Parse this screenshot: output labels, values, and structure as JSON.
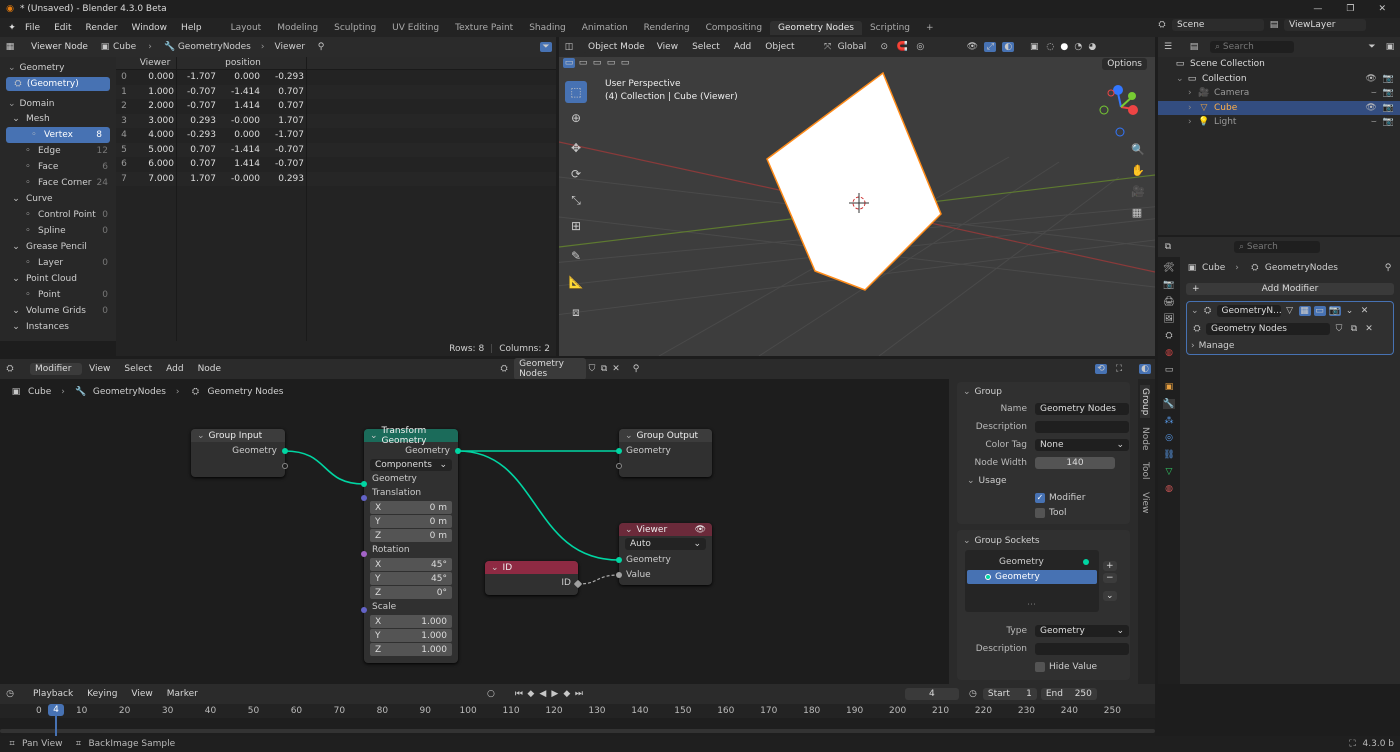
{
  "app_title": "* (Unsaved) - Blender 4.3.0 Beta",
  "menu": [
    "File",
    "Edit",
    "Render",
    "Window",
    "Help"
  ],
  "workspaces": [
    "Layout",
    "Modeling",
    "Sculpting",
    "UV Editing",
    "Texture Paint",
    "Shading",
    "Animation",
    "Rendering",
    "Compositing",
    "Geometry Nodes",
    "Scripting"
  ],
  "scene": "Scene",
  "viewlayer": "ViewLayer",
  "spreadsheet": {
    "mode": "Viewer Node",
    "object": "Cube",
    "modifier": "GeometryNodes",
    "node": "Viewer",
    "geometry_label": "Geometry",
    "geometry_item": "(Geometry)",
    "domain_label": "Domain",
    "tree": [
      {
        "label": "Mesh",
        "count": "",
        "indent": 0
      },
      {
        "label": "Vertex",
        "count": "8",
        "indent": 1
      },
      {
        "label": "Edge",
        "count": "12",
        "indent": 1
      },
      {
        "label": "Face",
        "count": "6",
        "indent": 1
      },
      {
        "label": "Face Corner",
        "count": "24",
        "indent": 1
      },
      {
        "label": "Curve",
        "count": "",
        "indent": 0
      },
      {
        "label": "Control Point",
        "count": "0",
        "indent": 1
      },
      {
        "label": "Spline",
        "count": "0",
        "indent": 1
      },
      {
        "label": "Grease Pencil",
        "count": "",
        "indent": 0
      },
      {
        "label": "Layer",
        "count": "0",
        "indent": 1
      },
      {
        "label": "Point Cloud",
        "count": "",
        "indent": 0
      },
      {
        "label": "Point",
        "count": "0",
        "indent": 1
      },
      {
        "label": "Volume Grids",
        "count": "0",
        "indent": 0
      },
      {
        "label": "Instances",
        "count": "",
        "indent": 0
      }
    ],
    "col_viewer": "Viewer",
    "col_position": "position",
    "rows": [
      [
        "0",
        "0.000",
        "-1.707",
        "0.000",
        "-0.293"
      ],
      [
        "1",
        "1.000",
        "-0.707",
        "-1.414",
        "0.707"
      ],
      [
        "2",
        "2.000",
        "-0.707",
        "1.414",
        "0.707"
      ],
      [
        "3",
        "3.000",
        "0.293",
        "-0.000",
        "1.707"
      ],
      [
        "4",
        "4.000",
        "-0.293",
        "0.000",
        "-1.707"
      ],
      [
        "5",
        "5.000",
        "0.707",
        "-1.414",
        "-0.707"
      ],
      [
        "6",
        "6.000",
        "0.707",
        "1.414",
        "-0.707"
      ],
      [
        "7",
        "7.000",
        "1.707",
        "-0.000",
        "0.293"
      ]
    ],
    "rows_label": "Rows: 8",
    "columns_label": "Columns: 2"
  },
  "viewport": {
    "mode": "Object Mode",
    "menus": [
      "View",
      "Select",
      "Add",
      "Object"
    ],
    "transform": "Global",
    "options": "Options",
    "info_line1": "User Perspective",
    "info_line2": "(4) Collection | Cube (Viewer)"
  },
  "outliner": {
    "search_placeholder": "Search",
    "items": [
      {
        "label": "Scene Collection",
        "indent": 0
      },
      {
        "label": "Collection",
        "indent": 1
      },
      {
        "label": "Camera",
        "indent": 2
      },
      {
        "label": "Cube",
        "indent": 2
      },
      {
        "label": "Light",
        "indent": 2
      }
    ]
  },
  "properties": {
    "search_placeholder": "Search",
    "breadcrumb_object": "Cube",
    "breadcrumb_modifier": "GeometryNodes",
    "add_modifier": "Add Modifier",
    "modifier_name": "GeometryN...",
    "node_group": "Geometry Nodes",
    "manage": "Manage"
  },
  "node_editor": {
    "type": "Modifier",
    "menus": [
      "View",
      "Select",
      "Add",
      "Node"
    ],
    "group_name": "Geometry Nodes",
    "breadcrumb": [
      "Cube",
      "GeometryNodes",
      "Geometry Nodes"
    ],
    "group_input": {
      "title": "Group Input",
      "out": "Geometry"
    },
    "transform": {
      "title": "Transform Geometry",
      "out": "Geometry",
      "mode": "Components",
      "in_geometry": "Geometry",
      "translation": "Translation",
      "rotation": "Rotation",
      "scale": "Scale",
      "t": [
        [
          "X",
          "0 m"
        ],
        [
          "Y",
          "0 m"
        ],
        [
          "Z",
          "0 m"
        ]
      ],
      "r": [
        [
          "X",
          "45°"
        ],
        [
          "Y",
          "45°"
        ],
        [
          "Z",
          "0°"
        ]
      ],
      "s": [
        [
          "X",
          "1.000"
        ],
        [
          "Y",
          "1.000"
        ],
        [
          "Z",
          "1.000"
        ]
      ]
    },
    "group_output": {
      "title": "Group Output",
      "in": "Geometry"
    },
    "viewer": {
      "title": "Viewer",
      "domain": "Auto",
      "in_geometry": "Geometry",
      "in_value": "Value"
    },
    "id_node": {
      "title": "ID",
      "out": "ID"
    }
  },
  "sidebar": {
    "tabs": [
      "Group",
      "Node",
      "Tool",
      "View"
    ],
    "group_title": "Group",
    "name_label": "Name",
    "name_value": "Geometry Nodes",
    "description_label": "Description",
    "color_tag_label": "Color Tag",
    "color_tag_value": "None",
    "node_width_label": "Node Width",
    "node_width_value": "140",
    "usage_label": "Usage",
    "modifier_label": "Modifier",
    "tool_label": "Tool",
    "sockets_title": "Group Sockets",
    "socket_out": "Geometry",
    "socket_in": "Geometry",
    "type_label": "Type",
    "type_value": "Geometry",
    "desc2_label": "Description",
    "hide_value_label": "Hide Value"
  },
  "timeline": {
    "menus": [
      "Playback",
      "Keying",
      "View",
      "Marker"
    ],
    "current_frame": "4",
    "start_label": "Start",
    "start_value": "1",
    "end_label": "End",
    "end_value": "250",
    "ticks": [
      "0",
      "10",
      "20",
      "30",
      "40",
      "50",
      "60",
      "70",
      "80",
      "90",
      "100",
      "110",
      "120",
      "130",
      "140",
      "150",
      "160",
      "170",
      "180",
      "190",
      "200",
      "210",
      "220",
      "230",
      "240",
      "250"
    ],
    "playhead": "4"
  },
  "status": {
    "left1": "Pan View",
    "left2": "BackImage Sample",
    "version": "4.3.0 b"
  },
  "colors": {
    "accent": "#4772b3",
    "geometry_socket": "#00d6a3",
    "transform_header": "#1b6b5a",
    "viewer_header": "#6b2a3a",
    "id_header": "#8e2a43",
    "orange": "#ff8c1a"
  }
}
